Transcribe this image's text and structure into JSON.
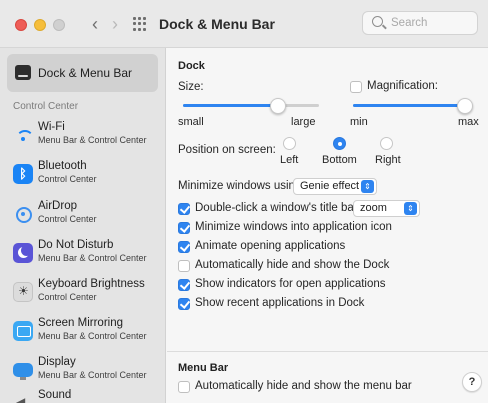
{
  "window": {
    "title": "Dock & Menu Bar",
    "search_placeholder": "Search"
  },
  "sidebar": {
    "selected_label": "Dock & Menu Bar",
    "section_label": "Control Center",
    "items": [
      {
        "label": "Wi-Fi",
        "sub": "Menu Bar & Control Center",
        "icon": "wifi-icon"
      },
      {
        "label": "Bluetooth",
        "sub": "Control Center",
        "icon": "bluetooth-icon"
      },
      {
        "label": "AirDrop",
        "sub": "Control Center",
        "icon": "airdrop-icon"
      },
      {
        "label": "Do Not Disturb",
        "sub": "Menu Bar & Control Center",
        "icon": "moon-icon"
      },
      {
        "label": "Keyboard Brightness",
        "sub": "Control Center",
        "icon": "keyboard-brightness-icon"
      },
      {
        "label": "Screen Mirroring",
        "sub": "Menu Bar & Control Center",
        "icon": "screen-mirroring-icon"
      },
      {
        "label": "Display",
        "sub": "Menu Bar & Control Center",
        "icon": "display-icon"
      },
      {
        "label": "Sound",
        "sub": "",
        "icon": "speaker-icon"
      }
    ]
  },
  "dock": {
    "heading": "Dock",
    "size_label": "Size:",
    "size_min": "small",
    "size_max": "large",
    "size_value": 0.7,
    "magnification_label": "Magnification:",
    "magnification_checked": false,
    "mag_min": "min",
    "mag_max": "max",
    "mag_value": 1.0,
    "position_label": "Position on screen:",
    "position_options": [
      "Left",
      "Bottom",
      "Right"
    ],
    "position_selected": "Bottom",
    "minimize_label": "Minimize windows using:",
    "minimize_value": "Genie effect",
    "options": [
      {
        "label": "Double-click a window's title bar to",
        "checked": true
      },
      {
        "label": "Minimize windows into application icon",
        "checked": true
      },
      {
        "label": "Animate opening applications",
        "checked": true
      },
      {
        "label": "Automatically hide and show the Dock",
        "checked": false
      },
      {
        "label": "Show indicators for open applications",
        "checked": true
      },
      {
        "label": "Show recent applications in Dock",
        "checked": true
      }
    ],
    "double_click_action": "zoom"
  },
  "menubar": {
    "heading": "Menu Bar",
    "autohide_label": "Automatically hide and show the menu bar",
    "autohide_checked": false
  },
  "help_label": "?",
  "colors": {
    "accent": "#2e84f0",
    "close": "#ee5d57",
    "minimize": "#f6be3b"
  }
}
